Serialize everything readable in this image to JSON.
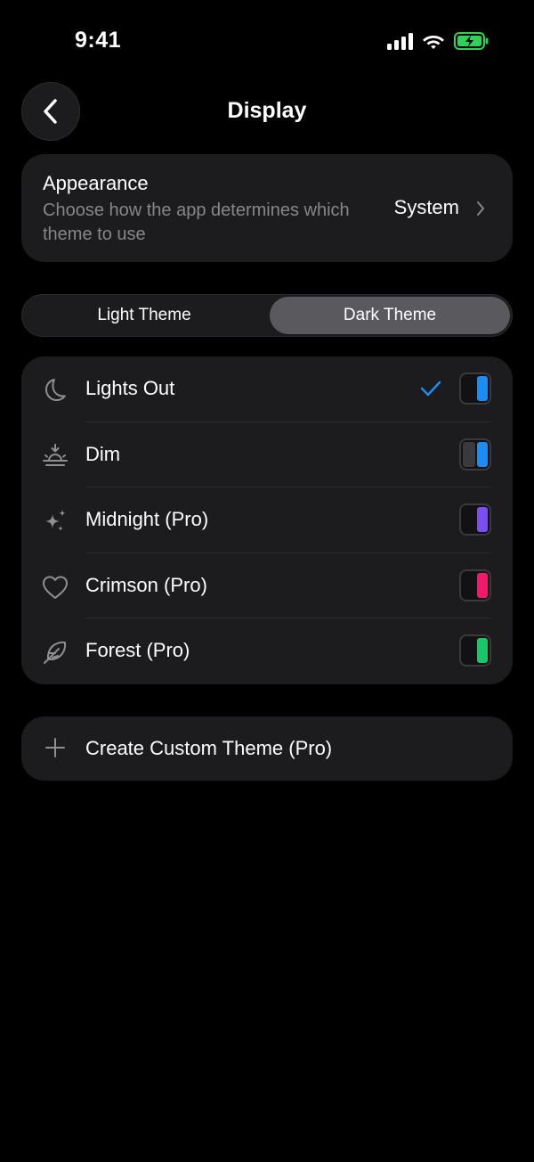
{
  "status": {
    "time": "9:41"
  },
  "header": {
    "title": "Display"
  },
  "appearance": {
    "title": "Appearance",
    "description": "Choose how the app determines which theme to use",
    "value": "System"
  },
  "segment": {
    "left": "Light Theme",
    "right": "Dark Theme",
    "selected": "Dark Theme"
  },
  "themes": [
    {
      "label": "Lights Out",
      "icon": "moon-icon",
      "accent": "#1d8cf0",
      "selected": true
    },
    {
      "label": "Dim",
      "icon": "sunset-icon",
      "accent": "#1d8cf0",
      "selected": false
    },
    {
      "label": "Midnight (Pro)",
      "icon": "sparkles-icon",
      "accent": "#7a4ff0",
      "selected": false
    },
    {
      "label": "Crimson (Pro)",
      "icon": "heart-icon",
      "accent": "#f0196e",
      "selected": false
    },
    {
      "label": "Forest (Pro)",
      "icon": "feather-icon",
      "accent": "#1cc46a",
      "selected": false
    }
  ],
  "create": {
    "label": "Create Custom Theme (Pro)"
  },
  "colors": {
    "background": "#000000",
    "card": "#1c1c1e",
    "check": "#1d8cf0",
    "battery": "#30d158"
  }
}
